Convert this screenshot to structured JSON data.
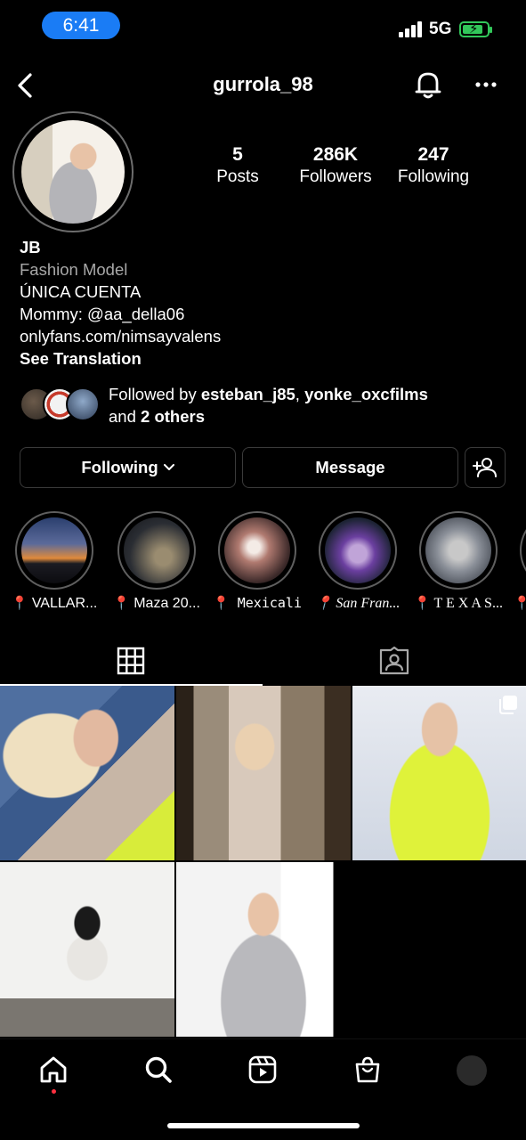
{
  "status_bar": {
    "time": "6:41",
    "network": "5G",
    "colors": {
      "time_pill": "#1a7cf5",
      "battery": "#32c75a"
    }
  },
  "header": {
    "username": "gurrola_98",
    "icons": [
      "back-icon",
      "bell-icon",
      "more-icon"
    ]
  },
  "stats": [
    {
      "value": "5",
      "label": "Posts"
    },
    {
      "value": "286K",
      "label": "Followers"
    },
    {
      "value": "247",
      "label": "Following"
    }
  ],
  "bio": {
    "name": "JB",
    "category": "Fashion Model",
    "line1": "ÚNICA CUENTA",
    "line2": "Mommy: @aa_della06",
    "link": "onlyfans.com/nimsayvalens",
    "see_translation": "See Translation"
  },
  "followed_by": {
    "prefix": "Followed by ",
    "user1": "esteban_j85",
    "separator": ", ",
    "user2": "yonke_oxcfilms",
    "and_text": "and ",
    "others": "2 others"
  },
  "actions": {
    "following": "Following",
    "message": "Message"
  },
  "highlights": [
    {
      "label": "VALLAR..."
    },
    {
      "label": "Maza 20..."
    },
    {
      "label": "Mexicali"
    },
    {
      "label": "San Fran..."
    },
    {
      "label": "T E X A S..."
    }
  ],
  "tabs": [
    "grid-tab",
    "tagged-tab"
  ],
  "bottom_nav": [
    "home-icon",
    "search-icon",
    "reels-icon",
    "shop-icon",
    "profile-avatar"
  ],
  "colors": {
    "background": "#000000",
    "secondary_text": "#a8a8a8",
    "notification_dot": "#ff3040"
  }
}
